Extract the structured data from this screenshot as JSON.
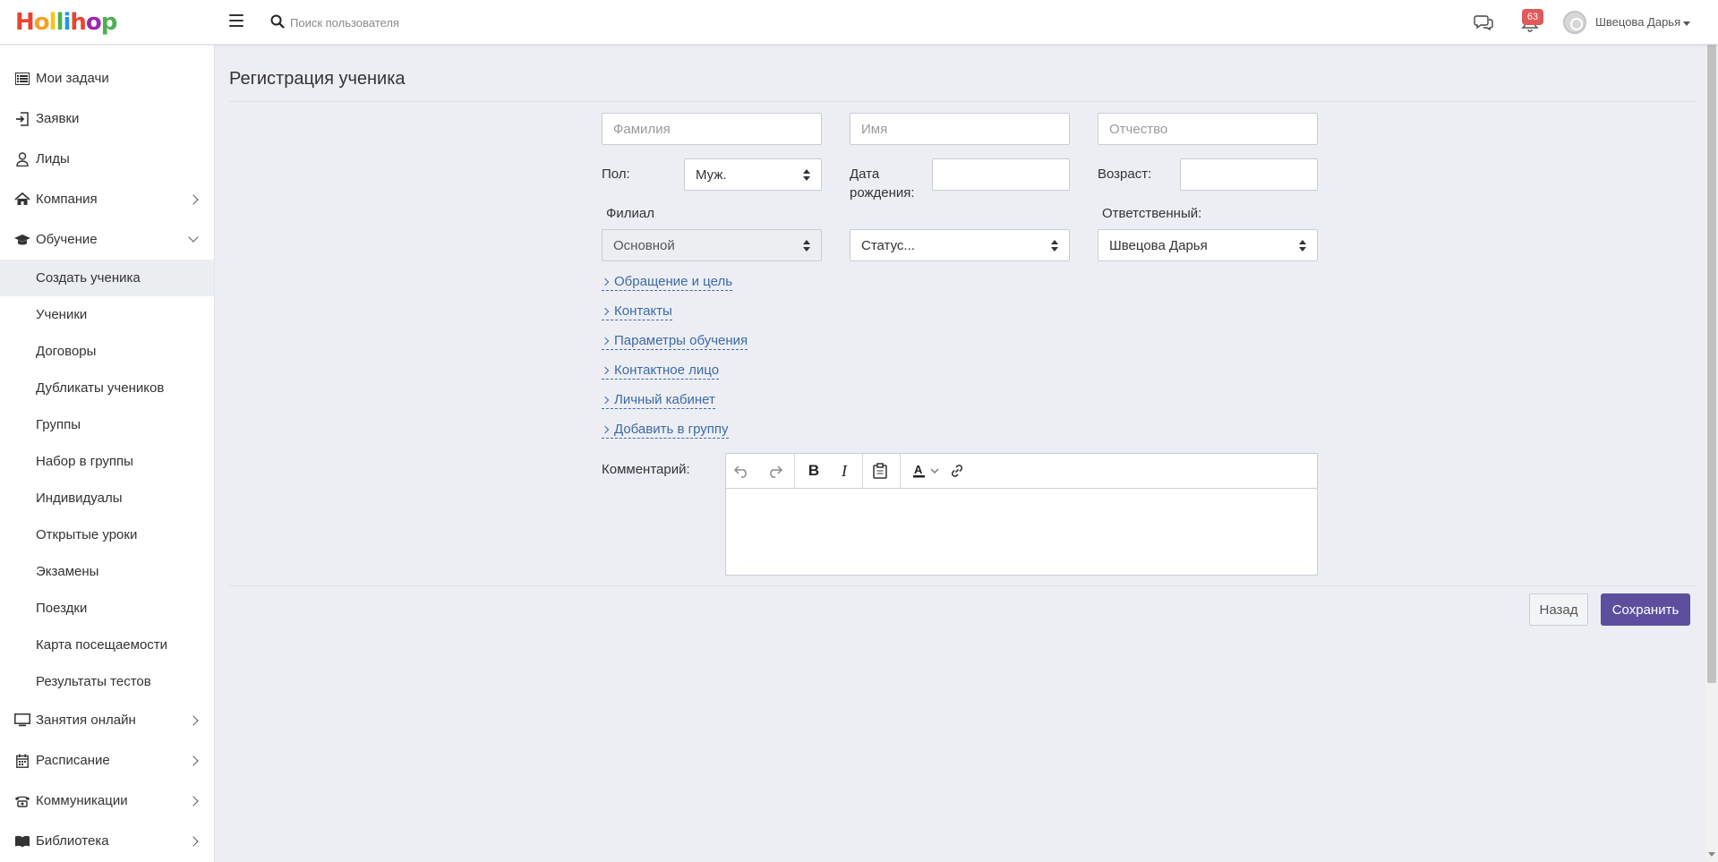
{
  "logo": {
    "letters": [
      "H",
      "o",
      "l",
      "l",
      "i",
      "h",
      "o",
      "p"
    ],
    "colors": [
      "#e8432e",
      "#f2a324",
      "#f5c518",
      "#4caf50",
      "#2196f3",
      "#e8432e",
      "#9c27b0",
      "#4caf50"
    ]
  },
  "header": {
    "search_placeholder": "Поиск пользователя",
    "notifications_count": "63",
    "user_name": "Швецова Дарья"
  },
  "sidebar": {
    "items": [
      {
        "label": "Мои задачи",
        "icon": "list-icon"
      },
      {
        "label": "Заявки",
        "icon": "login-icon"
      },
      {
        "label": "Лиды",
        "icon": "user-icon"
      },
      {
        "label": "Компания",
        "icon": "home-icon"
      },
      {
        "label": "Обучение",
        "icon": "graduation-cap-icon"
      }
    ],
    "sub_items": [
      "Создать ученика",
      "Ученики",
      "Договоры",
      "Дубликаты учеников",
      "Группы",
      "Набор в группы",
      "Индивидуалы",
      "Открытые уроки",
      "Экзамены",
      "Поездки",
      "Карта посещаемости",
      "Результаты тестов"
    ],
    "bottom_items": [
      {
        "label": "Занятия онлайн",
        "icon": "monitor-icon"
      },
      {
        "label": "Расписание",
        "icon": "calendar-icon"
      },
      {
        "label": "Коммуникации",
        "icon": "phone-icon"
      },
      {
        "label": "Библиотека",
        "icon": "book-icon"
      }
    ]
  },
  "page": {
    "title": "Регистрация ученика",
    "last_name_placeholder": "Фамилия",
    "first_name_placeholder": "Имя",
    "middle_name_placeholder": "Отчество",
    "gender_label": "Пол:",
    "gender_value": "Муж.",
    "birth_label_line1": "Дата",
    "birth_label_line2": "рождения:",
    "age_label": "Возраст:",
    "branch_label": "Филиал",
    "branch_value": "Основной",
    "status_value": "Статус...",
    "responsible_label": "Ответственный:",
    "responsible_value": "Швецова Дарья",
    "sections": [
      "Обращение и цель",
      "Контакты",
      "Параметры обучения",
      "Контактное лицо",
      "Личный кабинет",
      "Добавить в группу"
    ],
    "comment_label": "Комментарий:",
    "back_button": "Назад",
    "save_button": "Сохранить"
  },
  "colors": {
    "accent": "#5d4f9e",
    "link": "#3d6aa6",
    "badge": "#e05a5a"
  }
}
